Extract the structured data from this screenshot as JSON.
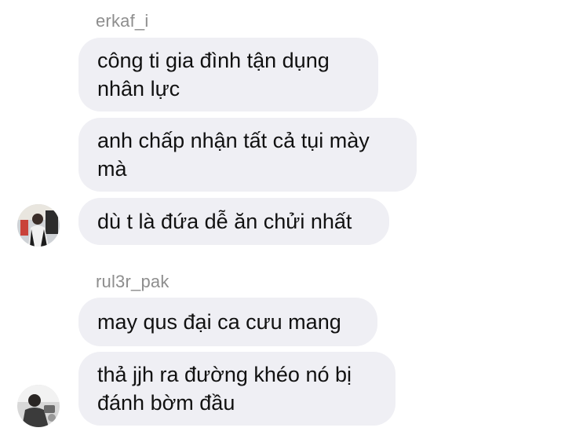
{
  "groups": [
    {
      "sender": "erkaf_i",
      "avatar_icon": "user-avatar-photo",
      "messages": [
        "công ti gia đình tận dụng\nnhân lực",
        "anh chấp nhận tất cả tụi mày\nmà",
        "dù t là đứa dễ ăn chửi nhất"
      ]
    },
    {
      "sender": "rul3r_pak",
      "avatar_icon": "user-avatar-photo",
      "messages": [
        "may qus đại ca cưu mang",
        "thả jjh ra đường khéo nó bị\nđánh bờm đầu"
      ]
    }
  ],
  "colors": {
    "bubble": "#efeff4",
    "text": "#111111",
    "sender": "#8e8e8e"
  }
}
